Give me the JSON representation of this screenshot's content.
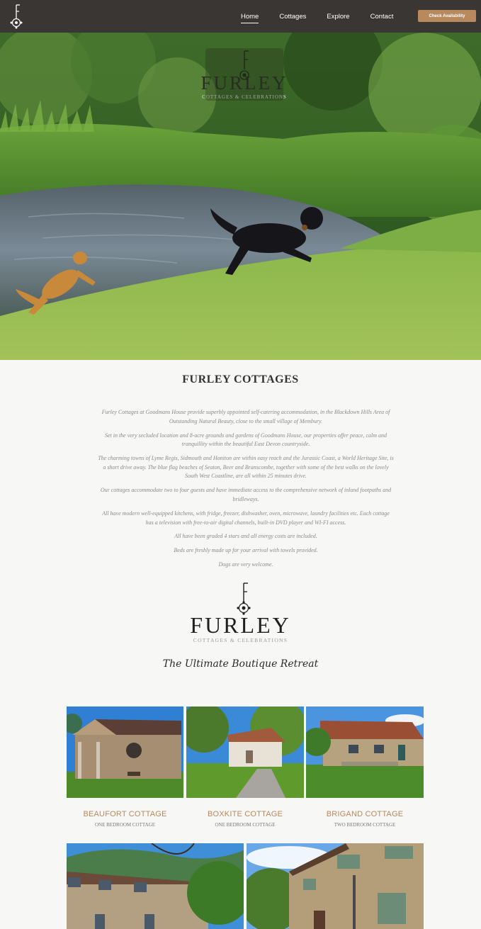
{
  "nav": {
    "logo_letter": "F",
    "links": [
      "Home",
      "Cottages",
      "Explore",
      "Contact"
    ],
    "cta_label": "Check Availability"
  },
  "hero": {
    "logo_letter": "F",
    "brand": "FURLEY",
    "subtitle": "COTTAGES & CELEBRATIONS"
  },
  "intro": {
    "title": "FURLEY COTTAGES",
    "paragraphs": [
      "Furley Cottages at Goodmans House provide superbly appointed self-catering accommodation, in the Blackdown Hills Area of Outstanding Natural Beauty, close to the small village of Membury.",
      "Set in the very secluded location and 8-acre grounds and gardens of Goodmans House, our properties offer peace, calm and tranquillity within the beautiful East Devon countryside.",
      "The charming towns of Lyme Regis, Sidmouth and Honiton are within easy reach and the Jurassic Coast, a World Heritage Site, is a short drive away.  The blue flag beaches of Seaton, Beer and Branscombe, together with some of the best walks on the lovely South West Coastline, are all within 25 minutes drive.",
      "Our cottages accommodate two to four guests and have immediate access to the comprehensive network of inland footpaths and bridleways.",
      "All have modern well-equipped kitchens, with fridge, freezer, dishwasher, oven, microwave, laundry facilities etc. Each cottage has a television with free-to-air digital channels, built-in DVD player and WI-FI access.",
      "All have been graded 4 stars and all energy costs are included.",
      "Beds are freshly made up for your arrival with towels provided.",
      "Dogs are very welcome."
    ]
  },
  "logo_block": {
    "logo_letter": "F",
    "brand": "FURLEY",
    "subtitle": "COTTAGES & CELEBRATIONS",
    "tagline": "The Ultimate Boutique Retreat"
  },
  "cottages": [
    {
      "name": "BEAUFORT COTTAGE",
      "sub": "ONE BEDROOM COTTAGE"
    },
    {
      "name": "BOXKITE COTTAGE",
      "sub": "ONE BEDROOM COTTAGE"
    },
    {
      "name": "BRIGAND COTTAGE",
      "sub": "TWO BEDROOM COTTAGE"
    }
  ],
  "colors": {
    "nav_bg": "#3a3634",
    "accent": "#b8895d",
    "page_bg": "#f7f7f5"
  }
}
